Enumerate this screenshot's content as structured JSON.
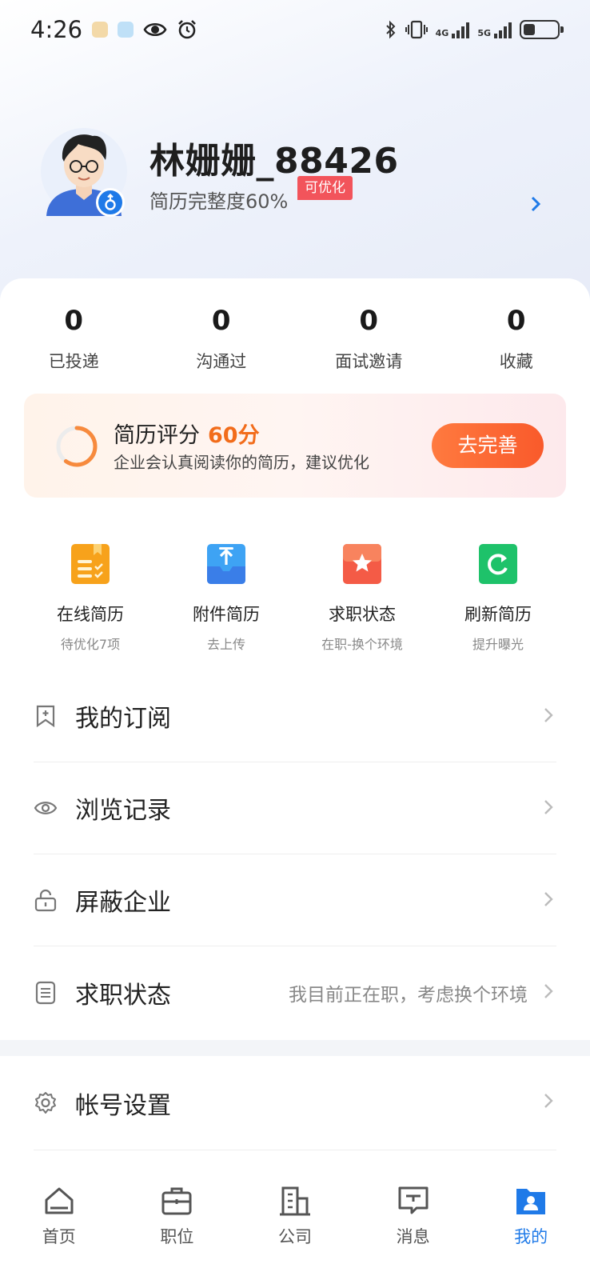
{
  "status_bar": {
    "time": "4:26",
    "network_1": "4G",
    "network_2": "5G"
  },
  "profile": {
    "username": "林姗姗_88426",
    "completeness": "简历完整度60%",
    "tag": "可优化"
  },
  "stats": [
    {
      "value": "0",
      "label": "已投递"
    },
    {
      "value": "0",
      "label": "沟通过"
    },
    {
      "value": "0",
      "label": "面试邀请"
    },
    {
      "value": "0",
      "label": "收藏"
    }
  ],
  "score_banner": {
    "title": "简历评分",
    "score": "60分",
    "score_fraction": 0.6,
    "description": "企业会认真阅读你的简历，建议优化",
    "button": "去完善"
  },
  "quick_actions": [
    {
      "icon": "online-resume-icon",
      "label": "在线简历",
      "sub": "待优化7项",
      "color": "#f7a21b"
    },
    {
      "icon": "attachment-upload-icon",
      "label": "附件简历",
      "sub": "去上传",
      "color": "#2f8cf2"
    },
    {
      "icon": "star-status-icon",
      "label": "求职状态",
      "sub": "在职-换个环境",
      "color": "#f25b3e"
    },
    {
      "icon": "refresh-icon",
      "label": "刷新简历",
      "sub": "提升曝光",
      "color": "#1ec26a"
    }
  ],
  "menu": [
    {
      "icon": "bookmark-icon",
      "label": "我的订阅",
      "value": ""
    },
    {
      "icon": "eye-icon",
      "label": "浏览记录",
      "value": ""
    },
    {
      "icon": "lock-icon",
      "label": "屏蔽企业",
      "value": ""
    },
    {
      "icon": "document-icon",
      "label": "求职状态",
      "value": "我目前正在职，考虑换个环境"
    }
  ],
  "settings": {
    "icon": "gear-icon",
    "label": "帐号设置"
  },
  "tabs": [
    {
      "icon": "home-icon",
      "label": "首页",
      "active": false
    },
    {
      "icon": "briefcase-icon",
      "label": "职位",
      "active": false
    },
    {
      "icon": "building-icon",
      "label": "公司",
      "active": false
    },
    {
      "icon": "message-icon",
      "label": "消息",
      "active": false
    },
    {
      "icon": "profile-icon",
      "label": "我的",
      "active": true
    }
  ],
  "colors": {
    "accent": "#1f7ae8",
    "score_orange": "#f26c1b",
    "tag_red": "#f2545b"
  }
}
